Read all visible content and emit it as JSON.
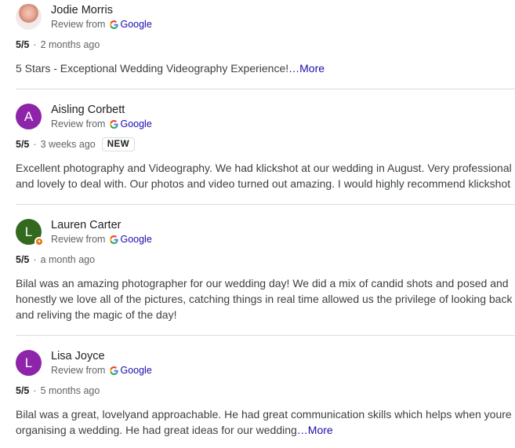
{
  "reviews": [
    {
      "name": "Jodie Morris",
      "avatar_letter": "",
      "avatar_color": "",
      "source_prefix": "Review from",
      "source_name": "Google",
      "score": "5/5",
      "age": "2 months ago",
      "badge": "",
      "text": "5 Stars - Exceptional Wedding Videography Experience!",
      "more": "…More"
    },
    {
      "name": "Aisling Corbett",
      "avatar_letter": "A",
      "avatar_color": "#8e24aa",
      "source_prefix": "Review from",
      "source_name": "Google",
      "score": "5/5",
      "age": "3 weeks ago",
      "badge": "NEW",
      "text": "Excellent photography and Videography. We had klickshot at our wedding in August. Very professional and lovely to deal with. Our photos and video turned out amazing. I would highly recommend klickshot",
      "more": ""
    },
    {
      "name": "Lauren Carter",
      "avatar_letter": "L",
      "avatar_color": "#33691e",
      "source_prefix": "Review from",
      "source_name": "Google",
      "score": "5/5",
      "age": "a month ago",
      "badge": "",
      "text": "Bilal was an amazing photographer for our wedding day! We did a mix of candid shots and posed and honestly we love all of the pictures, catching things in real time allowed us the privilege of looking back and reliving the magic of the day!",
      "more": ""
    },
    {
      "name": "Lisa Joyce",
      "avatar_letter": "L",
      "avatar_color": "#8e24aa",
      "source_prefix": "Review from",
      "source_name": "Google",
      "score": "5/5",
      "age": "5 months ago",
      "badge": "",
      "text": "Bilal was a great, lovelyand approachable. He had great communication skills which helps when youre organising a wedding. He had great ideas for our wedding",
      "more": "…More"
    }
  ],
  "colors": {
    "link": "#1a0dab",
    "divider": "#dadce0",
    "local_guide_badge": "#e8710a"
  }
}
